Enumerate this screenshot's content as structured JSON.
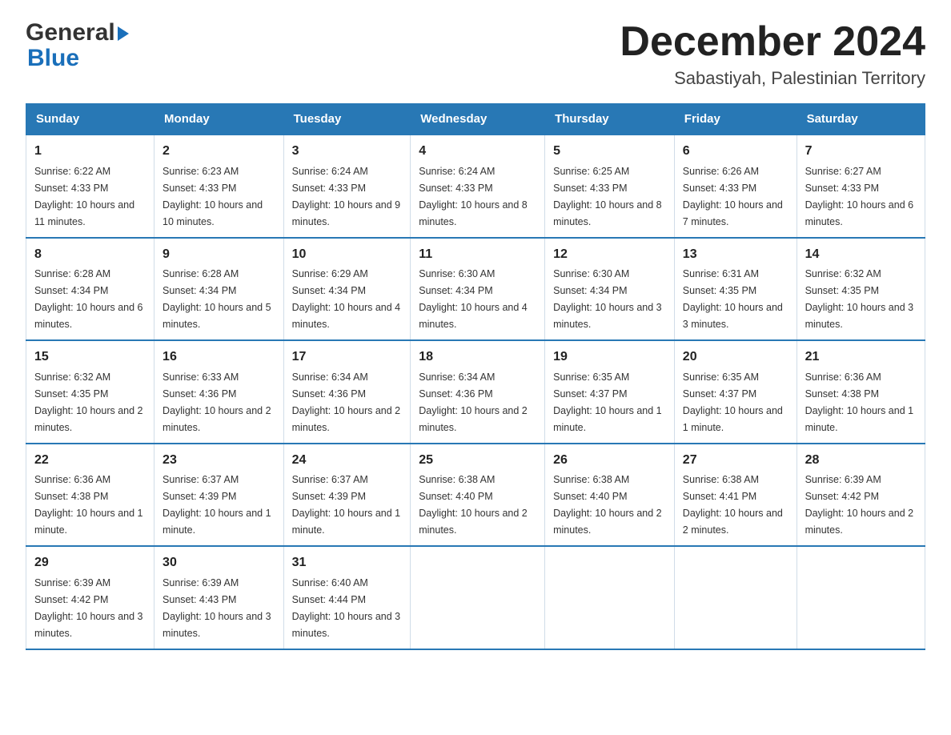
{
  "header": {
    "logo_general": "General",
    "logo_blue": "Blue",
    "title": "December 2024",
    "subtitle": "Sabastiyah, Palestinian Territory"
  },
  "days_of_week": [
    "Sunday",
    "Monday",
    "Tuesday",
    "Wednesday",
    "Thursday",
    "Friday",
    "Saturday"
  ],
  "weeks": [
    [
      {
        "day": "1",
        "sunrise": "6:22 AM",
        "sunset": "4:33 PM",
        "daylight": "10 hours and 11 minutes."
      },
      {
        "day": "2",
        "sunrise": "6:23 AM",
        "sunset": "4:33 PM",
        "daylight": "10 hours and 10 minutes."
      },
      {
        "day": "3",
        "sunrise": "6:24 AM",
        "sunset": "4:33 PM",
        "daylight": "10 hours and 9 minutes."
      },
      {
        "day": "4",
        "sunrise": "6:24 AM",
        "sunset": "4:33 PM",
        "daylight": "10 hours and 8 minutes."
      },
      {
        "day": "5",
        "sunrise": "6:25 AM",
        "sunset": "4:33 PM",
        "daylight": "10 hours and 8 minutes."
      },
      {
        "day": "6",
        "sunrise": "6:26 AM",
        "sunset": "4:33 PM",
        "daylight": "10 hours and 7 minutes."
      },
      {
        "day": "7",
        "sunrise": "6:27 AM",
        "sunset": "4:33 PM",
        "daylight": "10 hours and 6 minutes."
      }
    ],
    [
      {
        "day": "8",
        "sunrise": "6:28 AM",
        "sunset": "4:34 PM",
        "daylight": "10 hours and 6 minutes."
      },
      {
        "day": "9",
        "sunrise": "6:28 AM",
        "sunset": "4:34 PM",
        "daylight": "10 hours and 5 minutes."
      },
      {
        "day": "10",
        "sunrise": "6:29 AM",
        "sunset": "4:34 PM",
        "daylight": "10 hours and 4 minutes."
      },
      {
        "day": "11",
        "sunrise": "6:30 AM",
        "sunset": "4:34 PM",
        "daylight": "10 hours and 4 minutes."
      },
      {
        "day": "12",
        "sunrise": "6:30 AM",
        "sunset": "4:34 PM",
        "daylight": "10 hours and 3 minutes."
      },
      {
        "day": "13",
        "sunrise": "6:31 AM",
        "sunset": "4:35 PM",
        "daylight": "10 hours and 3 minutes."
      },
      {
        "day": "14",
        "sunrise": "6:32 AM",
        "sunset": "4:35 PM",
        "daylight": "10 hours and 3 minutes."
      }
    ],
    [
      {
        "day": "15",
        "sunrise": "6:32 AM",
        "sunset": "4:35 PM",
        "daylight": "10 hours and 2 minutes."
      },
      {
        "day": "16",
        "sunrise": "6:33 AM",
        "sunset": "4:36 PM",
        "daylight": "10 hours and 2 minutes."
      },
      {
        "day": "17",
        "sunrise": "6:34 AM",
        "sunset": "4:36 PM",
        "daylight": "10 hours and 2 minutes."
      },
      {
        "day": "18",
        "sunrise": "6:34 AM",
        "sunset": "4:36 PM",
        "daylight": "10 hours and 2 minutes."
      },
      {
        "day": "19",
        "sunrise": "6:35 AM",
        "sunset": "4:37 PM",
        "daylight": "10 hours and 1 minute."
      },
      {
        "day": "20",
        "sunrise": "6:35 AM",
        "sunset": "4:37 PM",
        "daylight": "10 hours and 1 minute."
      },
      {
        "day": "21",
        "sunrise": "6:36 AM",
        "sunset": "4:38 PM",
        "daylight": "10 hours and 1 minute."
      }
    ],
    [
      {
        "day": "22",
        "sunrise": "6:36 AM",
        "sunset": "4:38 PM",
        "daylight": "10 hours and 1 minute."
      },
      {
        "day": "23",
        "sunrise": "6:37 AM",
        "sunset": "4:39 PM",
        "daylight": "10 hours and 1 minute."
      },
      {
        "day": "24",
        "sunrise": "6:37 AM",
        "sunset": "4:39 PM",
        "daylight": "10 hours and 1 minute."
      },
      {
        "day": "25",
        "sunrise": "6:38 AM",
        "sunset": "4:40 PM",
        "daylight": "10 hours and 2 minutes."
      },
      {
        "day": "26",
        "sunrise": "6:38 AM",
        "sunset": "4:40 PM",
        "daylight": "10 hours and 2 minutes."
      },
      {
        "day": "27",
        "sunrise": "6:38 AM",
        "sunset": "4:41 PM",
        "daylight": "10 hours and 2 minutes."
      },
      {
        "day": "28",
        "sunrise": "6:39 AM",
        "sunset": "4:42 PM",
        "daylight": "10 hours and 2 minutes."
      }
    ],
    [
      {
        "day": "29",
        "sunrise": "6:39 AM",
        "sunset": "4:42 PM",
        "daylight": "10 hours and 3 minutes."
      },
      {
        "day": "30",
        "sunrise": "6:39 AM",
        "sunset": "4:43 PM",
        "daylight": "10 hours and 3 minutes."
      },
      {
        "day": "31",
        "sunrise": "6:40 AM",
        "sunset": "4:44 PM",
        "daylight": "10 hours and 3 minutes."
      },
      null,
      null,
      null,
      null
    ]
  ]
}
